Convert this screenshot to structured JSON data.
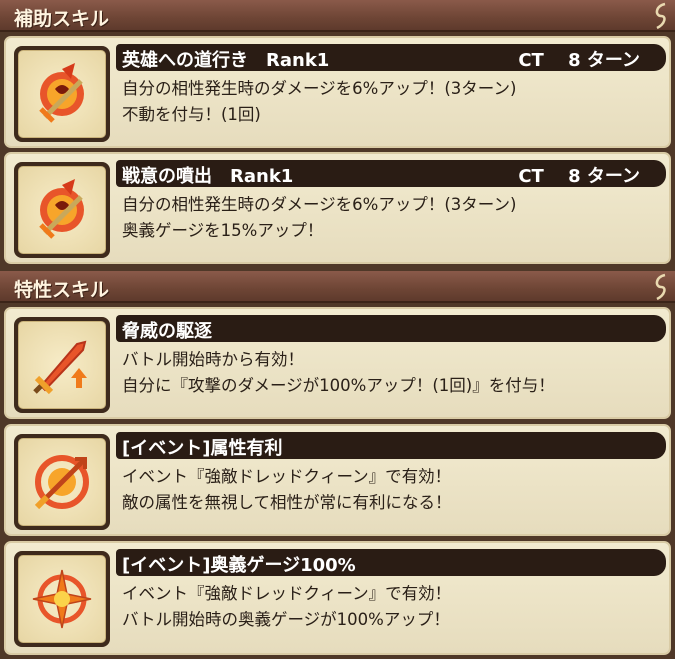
{
  "sections": {
    "support": {
      "title": "補助スキル"
    },
    "trait": {
      "title": "特性スキル"
    }
  },
  "skills": [
    {
      "name": "英雄への道行き　Rank1",
      "ct": "CT　 8 ターン",
      "lines": [
        "自分の相性発生時のダメージを6%アップ！(3ターン)",
        "不動を付与！(1回)"
      ],
      "icon": "flame-sword-icon"
    },
    {
      "name": "戦意の噴出　Rank1",
      "ct": "CT　 8 ターン",
      "lines": [
        "自分の相性発生時のダメージを6%アップ！(3ターン)",
        "奥義ゲージを15%アップ！"
      ],
      "icon": "flame-sword-icon"
    },
    {
      "name": "脅威の駆逐",
      "ct": "",
      "lines": [
        "バトル開始時から有効！",
        "自分に『攻撃のダメージが100%アップ！(1回)』を付与！"
      ],
      "icon": "sword-up-icon"
    },
    {
      "name": "[イベント]属性有利",
      "ct": "",
      "lines": [
        "イベント『強敵ドレッドクィーン』で有効！",
        "敵の属性を無視して相性が常に有利になる！"
      ],
      "icon": "element-arrow-icon"
    },
    {
      "name": "[イベント]奥義ゲージ100%",
      "ct": "",
      "lines": [
        "イベント『強敵ドレッドクィーン』で有効！",
        "バトル開始時の奥義ゲージが100%アップ！"
      ],
      "icon": "burst-star-icon"
    }
  ],
  "colors": {
    "header": "#6e4535",
    "card": "#efe7cb",
    "name_bar": "#2a1c14",
    "icon_orange": "#f07a1a"
  }
}
